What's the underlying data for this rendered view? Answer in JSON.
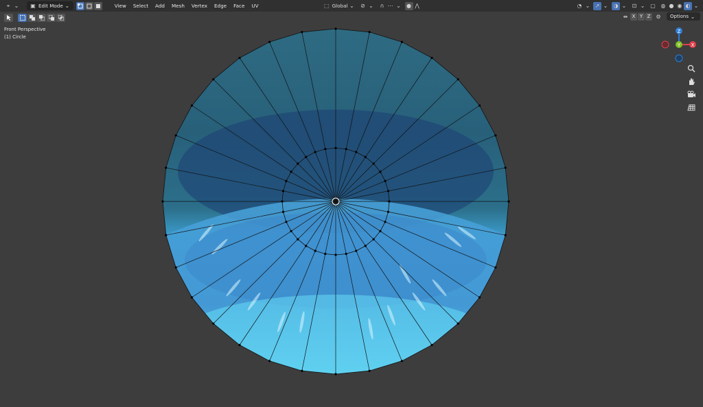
{
  "header": {
    "mode_label": "Edit Mode",
    "menus": [
      "View",
      "Select",
      "Add",
      "Mesh",
      "Vertex",
      "Edge",
      "Face",
      "UV"
    ],
    "transform_orientation": "Global",
    "options_label": "Options",
    "axis_buttons": [
      "X",
      "Y",
      "Z"
    ]
  },
  "viewport": {
    "view_name": "Front Perspective",
    "object_name": "(1) Circle"
  },
  "gizmo": {
    "z": "Z",
    "y": "Y",
    "x": "X"
  },
  "colors": {
    "accent": "#4772b3",
    "header_bg": "#303030",
    "viewport_bg": "#3d3d3d",
    "gizmo_x": "#e0414c",
    "gizmo_y": "#80c224",
    "gizmo_z": "#2f7fd6"
  },
  "icons": [
    "cursor-icon",
    "vertex-select-icon",
    "edge-select-icon",
    "face-select-icon",
    "magnet-icon",
    "proportional-icon",
    "zoom-icon",
    "hand-icon",
    "camera-icon",
    "grid-icon"
  ]
}
